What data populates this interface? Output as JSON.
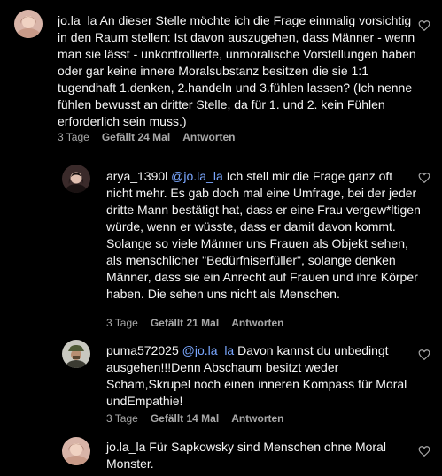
{
  "comments": [
    {
      "username": "jo.la_la",
      "mention": "",
      "text": "An dieser Stelle möchte ich die Frage einmalig vorsichtig in den Raum stellen: Ist davon auszugehen, dass Männer - wenn man sie lässt - unkontrollierte, unmoralische Vorstellungen haben oder gar keine innere Moralsubstanz besitzen die sie 1:1 tugendhaft 1.denken, 2.handeln und 3.fühlen lassen? (Ich nenne fühlen bewusst an dritter Stelle, da für 1. und 2. kein Fühlen erforderlich sein muss.)",
      "time": "3 Tage",
      "likes": "Gefällt 24 Mal",
      "reply": "Antworten",
      "avatar_icon": "avatar-woman-pink"
    },
    {
      "username": "arya_1390l",
      "mention": "@jo.la_la",
      "text": "Ich stell mir die Frage ganz oft nicht mehr. Es gab doch mal eine Umfrage, bei der jeder dritte Mann bestätigt hat, dass er eine Frau vergew*ltigen würde, wenn er wüsste, dass er damit davon kommt. Solange so viele Männer uns Frauen als Objekt sehen, als menschlicher \"Bedürfniserfüller\", solange denken Männer, dass sie ein Anrecht auf Frauen und ihre Körper haben. Die sehen uns nicht als Menschen.",
      "time": "3 Tage",
      "likes": "Gefällt 21 Mal",
      "reply": "Antworten",
      "avatar_icon": "avatar-woman-dark"
    },
    {
      "username": "puma572025",
      "mention": "@jo.la_la",
      "text": "Davon kannst du unbedingt ausgehen!!!Denn Abschaum besitzt weder Scham,Skrupel noch einen inneren Kompass für Moral undEmpathie!",
      "time": "3 Tage",
      "likes": "Gefällt 14 Mal",
      "reply": "Antworten",
      "avatar_icon": "avatar-man-hat"
    },
    {
      "username": "jo.la_la",
      "mention": "",
      "text": "Für Sapkowsky sind Menschen ohne Moral Monster.",
      "time": "",
      "likes": "",
      "reply": "",
      "avatar_icon": "avatar-woman-pink"
    }
  ],
  "colors": {
    "background": "#000000",
    "text": "#f5f5f5",
    "meta": "#a8a8a8",
    "mention": "#7aa7ff"
  },
  "icons": {
    "like": "heart-outline-icon"
  }
}
